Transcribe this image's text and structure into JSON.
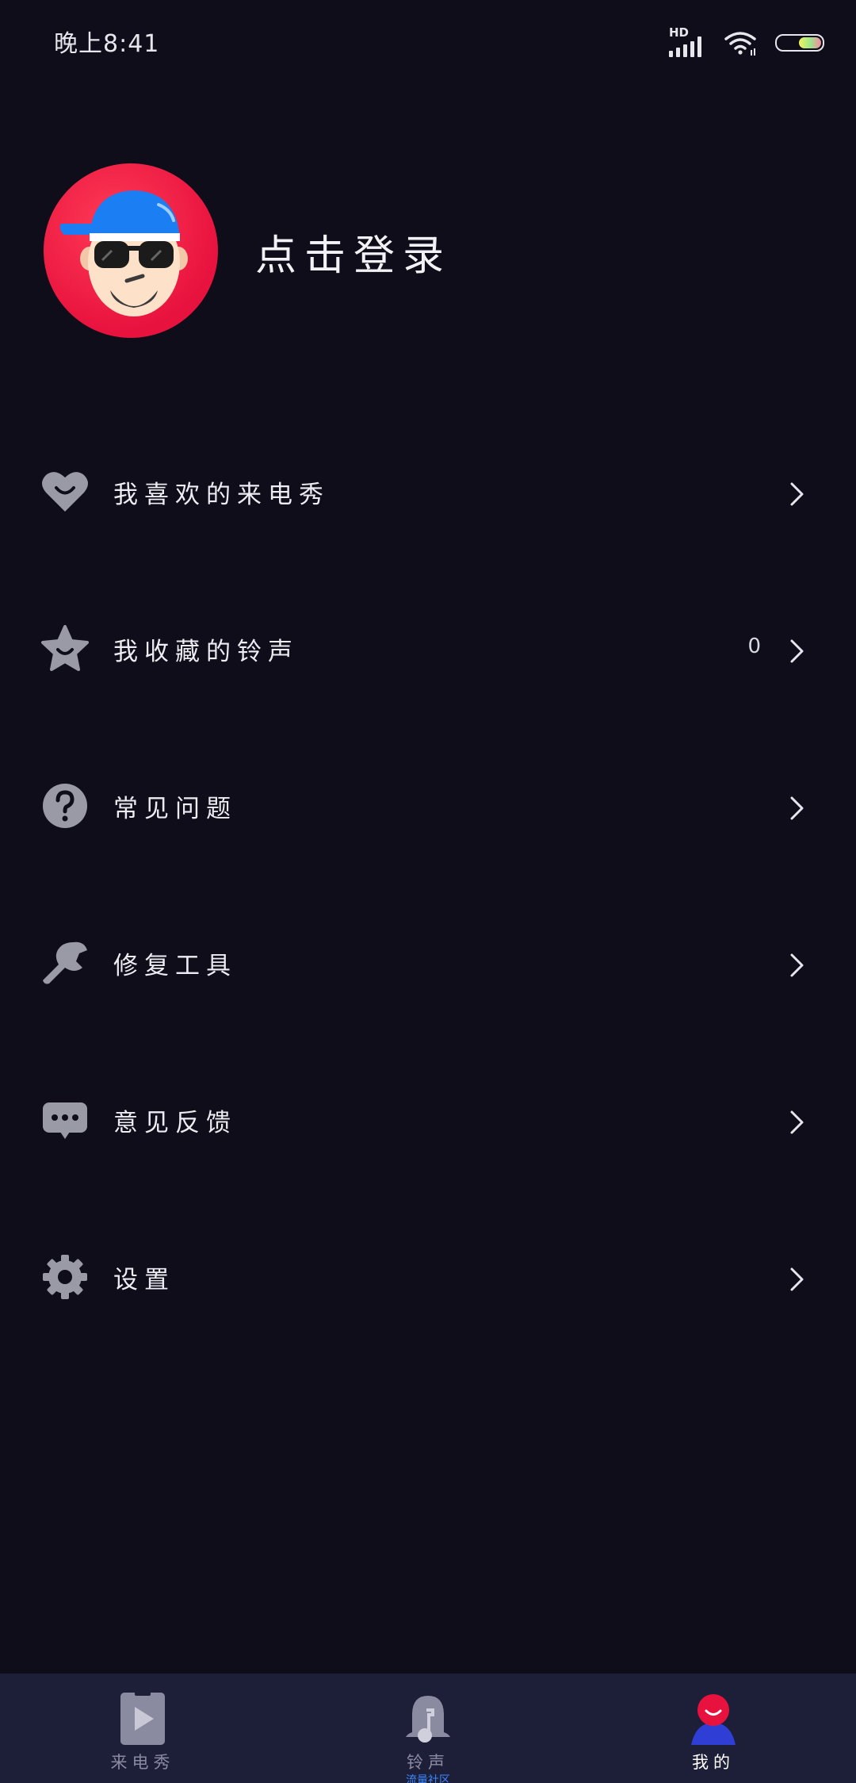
{
  "status_bar": {
    "time": "晚上8:41",
    "network": "HD"
  },
  "profile": {
    "login_label": "点击登录"
  },
  "menu": {
    "items": [
      {
        "label": "我喜欢的来电秀",
        "icon": "heart-smile-icon",
        "count": ""
      },
      {
        "label": "我收藏的铃声",
        "icon": "star-smile-icon",
        "count": "0"
      },
      {
        "label": "常见问题",
        "icon": "question-icon",
        "count": ""
      },
      {
        "label": "修复工具",
        "icon": "wrench-icon",
        "count": ""
      },
      {
        "label": "意见反馈",
        "icon": "chat-bubble-icon",
        "count": ""
      },
      {
        "label": "设置",
        "icon": "gear-icon",
        "count": ""
      }
    ]
  },
  "bottom_nav": {
    "tabs": [
      {
        "label": "来电秀",
        "icon": "play-card-icon",
        "active": false,
        "sub": ""
      },
      {
        "label": "铃声",
        "icon": "bell-music-icon",
        "active": false,
        "sub": "流量社区"
      },
      {
        "label": "我的",
        "icon": "user-smile-icon",
        "active": true,
        "sub": ""
      }
    ]
  },
  "colors": {
    "background": "#0e0d19",
    "nav_background": "#1d1e38",
    "icon_gray": "#9a9aa6",
    "accent_red": "#e8123e",
    "accent_blue": "#2f3fd6"
  }
}
